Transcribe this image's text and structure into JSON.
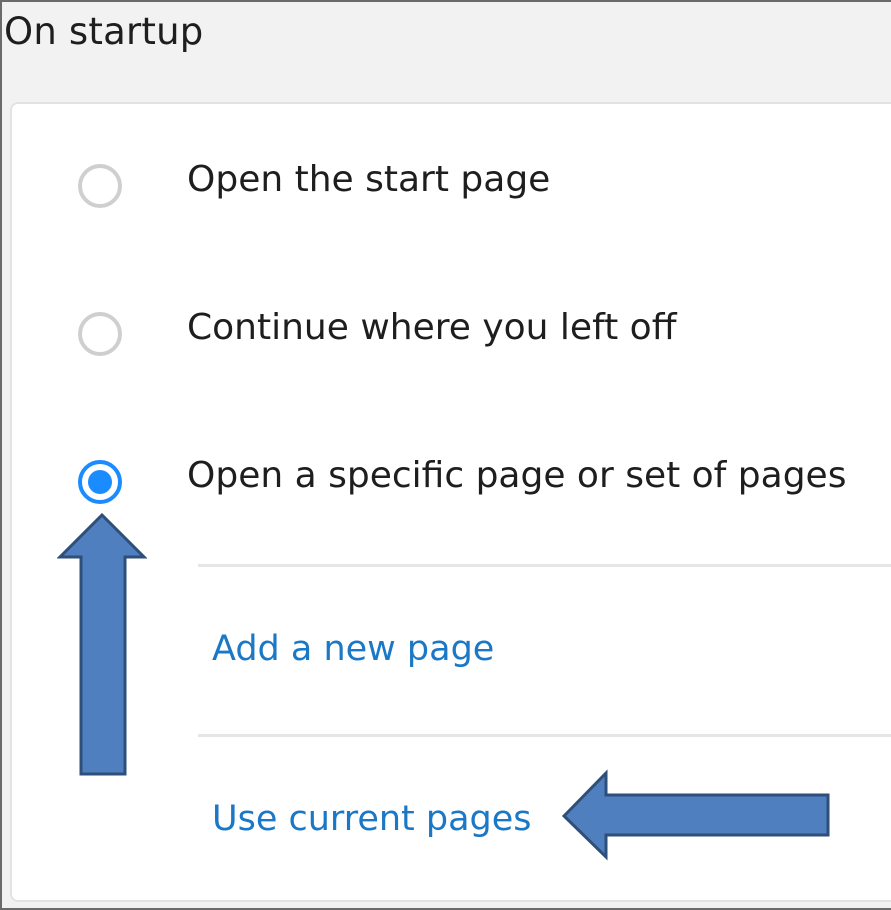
{
  "section": {
    "title": "On startup"
  },
  "options": [
    {
      "label": "Open the start page",
      "checked": false
    },
    {
      "label": "Continue where you left off",
      "checked": false
    },
    {
      "label": "Open a specific page or set of pages",
      "checked": true
    }
  ],
  "links": {
    "add_page": "Add a new page",
    "use_current": "Use current pages"
  },
  "colors": {
    "accent": "#1a8cff",
    "link": "#1b78c6",
    "annotation_fill": "#4f7fbf",
    "annotation_stroke": "#2e4f7a"
  },
  "annotations": [
    {
      "type": "arrow",
      "direction": "up",
      "points_to": "Open a specific page or set of pages"
    },
    {
      "type": "arrow",
      "direction": "left",
      "points_to": "Use current pages"
    }
  ]
}
